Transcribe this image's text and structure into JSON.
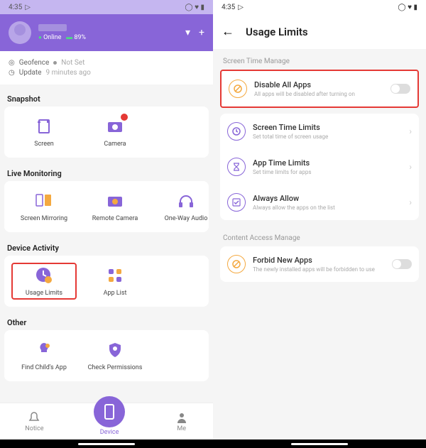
{
  "left": {
    "status": {
      "time": "4:35",
      "icons": "◯ ♥ ▮"
    },
    "profile": {
      "online_label": "Online",
      "battery": "89%"
    },
    "info": {
      "geo_label": "Geofence",
      "geo_value": "Not Set",
      "update_label": "Update",
      "update_value": "9 minutes ago"
    },
    "sections": {
      "snapshot": {
        "title": "Snapshot",
        "items": [
          {
            "label": "Screen"
          },
          {
            "label": "Camera"
          }
        ]
      },
      "live": {
        "title": "Live Monitoring",
        "items": [
          {
            "label": "Screen Mirroring"
          },
          {
            "label": "Remote Camera"
          },
          {
            "label": "One-Way Audio"
          }
        ]
      },
      "device": {
        "title": "Device Activity",
        "items": [
          {
            "label": "Usage Limits"
          },
          {
            "label": "App List"
          }
        ]
      },
      "other": {
        "title": "Other",
        "items": [
          {
            "label": "Find Child's App"
          },
          {
            "label": "Check Permissions"
          }
        ]
      }
    },
    "nav": {
      "notice": "Notice",
      "device": "Device",
      "me": "Me"
    }
  },
  "right": {
    "status": {
      "time": "4:35",
      "icons": "◯ ♥ ▮"
    },
    "title": "Usage Limits",
    "section1": "Screen Time Manage",
    "rows": [
      {
        "title": "Disable All Apps",
        "sub": "All apps will be disabled after turning on",
        "type": "toggle"
      },
      {
        "title": "Screen Time Limits",
        "sub": "Set total time of screen usage",
        "type": "chevron"
      },
      {
        "title": "App Time Limits",
        "sub": "Set time limits for apps",
        "type": "chevron"
      },
      {
        "title": "Always Allow",
        "sub": "Always allow the apps on the list",
        "type": "chevron"
      }
    ],
    "section2": "Content Access Manage",
    "rows2": [
      {
        "title": "Forbid New Apps",
        "sub": "The newly installed apps will be forbidden to use",
        "type": "toggle"
      }
    ]
  }
}
